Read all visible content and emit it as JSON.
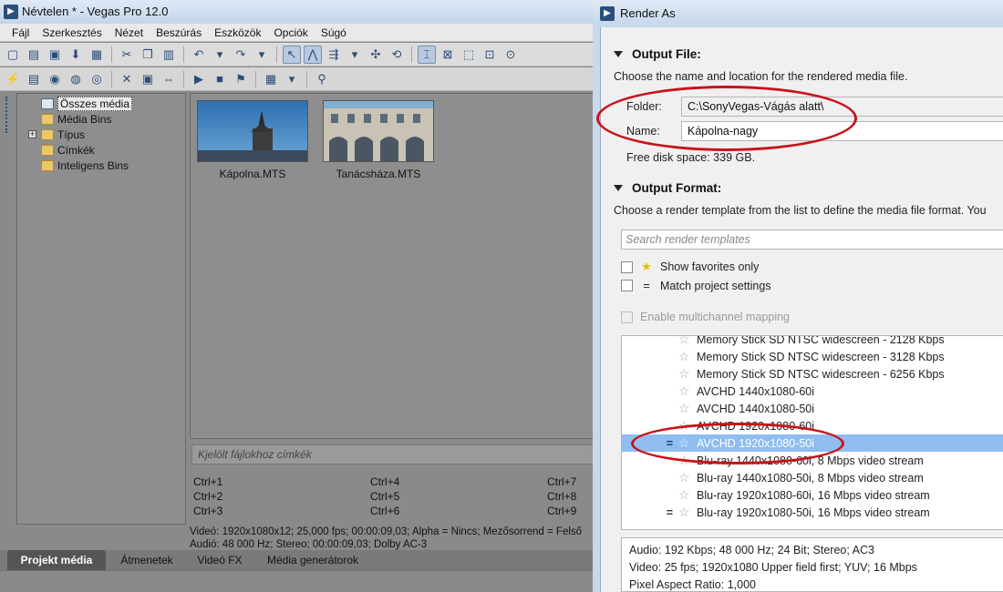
{
  "vegas": {
    "title": "Névtelen * - Vegas Pro 12.0",
    "menu": [
      "Fájl",
      "Szerkesztés",
      "Nézet",
      "Beszúrás",
      "Eszközök",
      "Opciók",
      "Súgó"
    ],
    "tree": [
      {
        "label": "Összes média",
        "selected": true
      },
      {
        "label": "Média Bins"
      },
      {
        "label": "Típus"
      },
      {
        "label": "Címkék"
      },
      {
        "label": "Inteligens Bins"
      }
    ],
    "expand_symbol": "+",
    "media": [
      {
        "caption": "Kápolna.MTS"
      },
      {
        "caption": "Tanácsháza.MTS"
      }
    ],
    "tag_placeholder": "Kjelölt fájlokhoz címkék",
    "shortcuts": [
      [
        "Ctrl+1",
        "Ctrl+4",
        "Ctrl+7"
      ],
      [
        "Ctrl+2",
        "Ctrl+5",
        "Ctrl+8"
      ],
      [
        "Ctrl+3",
        "Ctrl+6",
        "Ctrl+9"
      ]
    ],
    "info": {
      "video": "Videó: 1920x1080x12; 25,000 fps; 00:00:09,03; Alpha = Nincs; Mezősorrend = Felső",
      "audio": "Audió: 48 000 Hz; Stereo; 00:00:09,03; Dolby AC-3"
    },
    "tabs": [
      "Projekt média",
      "Átmenetek",
      "Videó FX",
      "Média generátorok"
    ],
    "active_tab": "Projekt média"
  },
  "render": {
    "title": "Render As",
    "output_file": {
      "heading": "Output File:",
      "description": "Choose the name and location for the rendered media file.",
      "folder_label": "Folder:",
      "folder_value": "C:\\SonyVegas-Vágás alatt\\",
      "name_label": "Name:",
      "name_value": "Kápolna-nagy",
      "free_space": "Free disk space: 339 GB."
    },
    "output_format": {
      "heading": "Output Format:",
      "description": "Choose a render template from the list to define the media file format. You",
      "search_placeholder": "Search render templates",
      "show_favorites": "Show favorites only",
      "match_project": "Match project settings",
      "multichannel": "Enable multichannel mapping",
      "match_symbol": "=",
      "star_symbol": "★"
    },
    "templates": [
      {
        "label": "Memory Stick SD NTSC widescreen - 2128 Kbps",
        "match": ""
      },
      {
        "label": "Memory Stick SD NTSC widescreen - 3128 Kbps",
        "match": ""
      },
      {
        "label": "Memory Stick SD NTSC widescreen - 6256 Kbps",
        "match": ""
      },
      {
        "label": "AVCHD 1440x1080-60i",
        "match": ""
      },
      {
        "label": "AVCHD 1440x1080-50i",
        "match": ""
      },
      {
        "label": "AVCHD 1920x1080-60i",
        "match": ""
      },
      {
        "label": "AVCHD 1920x1080-50i",
        "match": "=",
        "selected": true
      },
      {
        "label": "Blu-ray 1440x1080-60i, 8 Mbps video stream",
        "match": ""
      },
      {
        "label": "Blu-ray 1440x1080-50i, 8 Mbps video stream",
        "match": ""
      },
      {
        "label": "Blu-ray 1920x1080-60i, 16 Mbps video stream",
        "match": ""
      },
      {
        "label": "Blu-ray 1920x1080-50i, 16 Mbps video stream",
        "match": "="
      }
    ],
    "summary": [
      "Audio: 192 Kbps; 48 000 Hz; 24 Bit; Stereo; AC3",
      "Video: 25 fps; 1920x1080 Upper field first; YUV; 16 Mbps",
      "Pixel Aspect Ratio: 1,000"
    ]
  },
  "colors": {
    "annotation": "#c8121a",
    "selection": "#8fbdf0"
  }
}
